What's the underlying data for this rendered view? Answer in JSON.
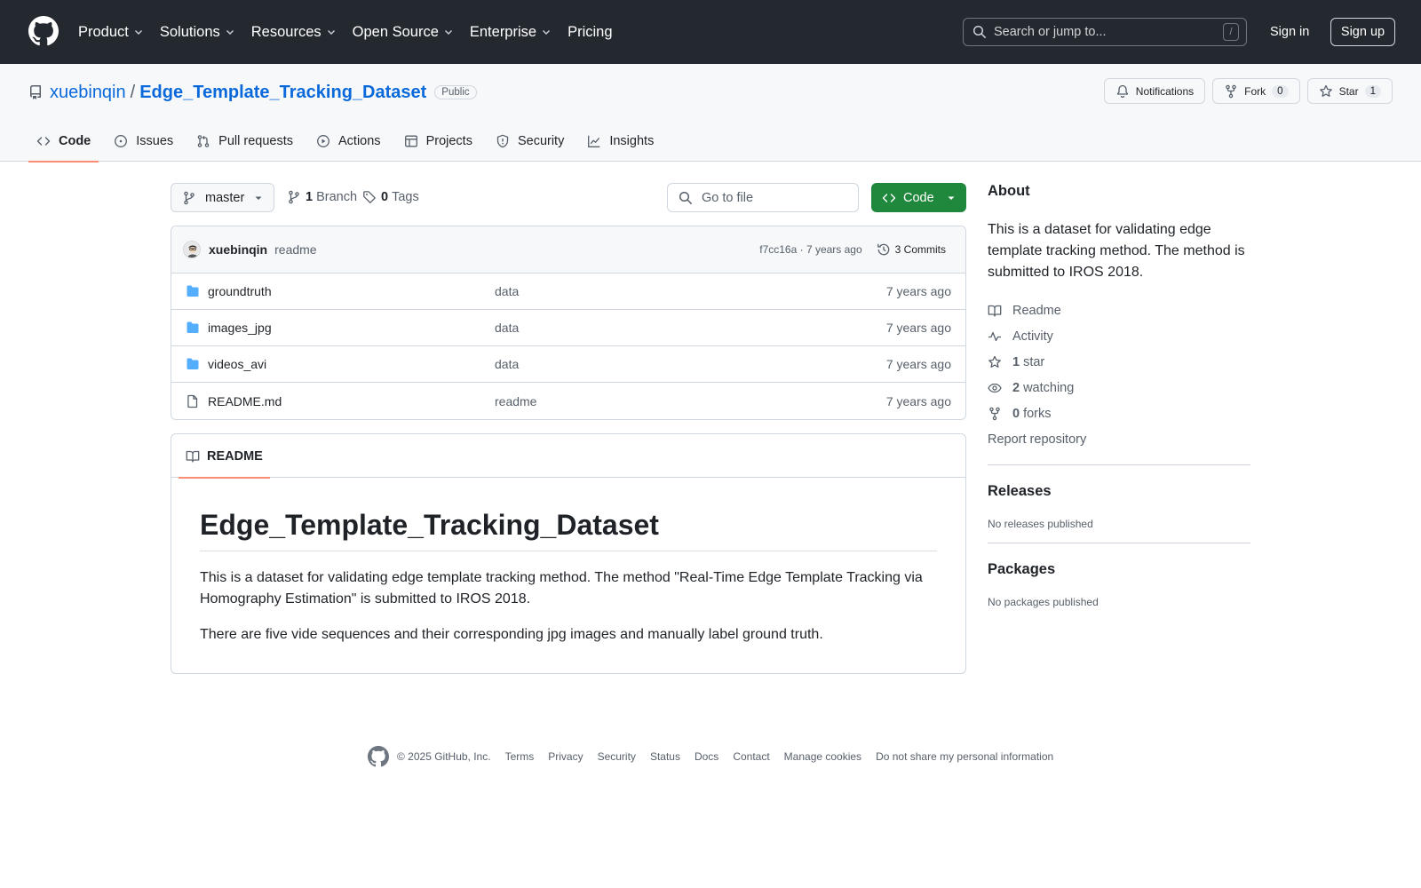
{
  "nav": {
    "items": [
      "Product",
      "Solutions",
      "Resources",
      "Open Source",
      "Enterprise",
      "Pricing"
    ],
    "search_placeholder": "Search or jump to...",
    "search_shortcut": "/",
    "sign_in": "Sign in",
    "sign_up": "Sign up"
  },
  "repo": {
    "owner": "xuebinqin",
    "separator": "/",
    "name": "Edge_Template_Tracking_Dataset",
    "visibility": "Public",
    "notifications_label": "Notifications",
    "fork_label": "Fork",
    "fork_count": "0",
    "star_label": "Star",
    "star_count": "1",
    "tabs": [
      "Code",
      "Issues",
      "Pull requests",
      "Actions",
      "Projects",
      "Security",
      "Insights"
    ],
    "active_tab": "Code"
  },
  "toolbar": {
    "branch": "master",
    "branch_count": "1",
    "branch_label": "Branch",
    "tag_count": "0",
    "tag_label": "Tags",
    "goto_placeholder": "Go to file",
    "code_button": "Code"
  },
  "latest_commit": {
    "author": "xuebinqin",
    "message": "readme",
    "sha_age": "f7cc16a · 7 years ago",
    "commits": "3 Commits"
  },
  "files": [
    {
      "type": "folder",
      "name": "groundtruth",
      "message": "data",
      "age": "7 years ago"
    },
    {
      "type": "folder",
      "name": "images_jpg",
      "message": "data",
      "age": "7 years ago"
    },
    {
      "type": "folder",
      "name": "videos_avi",
      "message": "data",
      "age": "7 years ago"
    },
    {
      "type": "file",
      "name": "README.md",
      "message": "readme",
      "age": "7 years ago"
    }
  ],
  "readme": {
    "tab": "README",
    "title": "Edge_Template_Tracking_Dataset",
    "p1": "This is a dataset for validating edge template tracking method. The method \"Real-Time Edge Template Tracking via Homography Estimation\" is submitted to IROS 2018.",
    "p2": "There are five vide sequences and their corresponding jpg images and manually label ground truth."
  },
  "about": {
    "heading": "About",
    "description": "This is a dataset for validating edge template tracking method. The method is submitted to IROS 2018.",
    "readme_link": "Readme",
    "activity_link": "Activity",
    "stars_count": "1",
    "stars_label": "star",
    "watching_count": "2",
    "watching_label": "watching",
    "forks_count": "0",
    "forks_label": "forks",
    "report": "Report repository"
  },
  "releases": {
    "heading": "Releases",
    "text": "No releases published"
  },
  "packages": {
    "heading": "Packages",
    "text": "No packages published"
  },
  "footer": {
    "copyright": "© 2025 GitHub, Inc.",
    "links": [
      "Terms",
      "Privacy",
      "Security",
      "Status",
      "Docs",
      "Contact",
      "Manage cookies",
      "Do not share my personal information"
    ]
  },
  "colors": {
    "header_bg": "#24292f",
    "link": "#0969da",
    "primary_button": "#1f883d",
    "active_tab_underline": "#fd8c73",
    "folder_icon": "#54aeff"
  }
}
